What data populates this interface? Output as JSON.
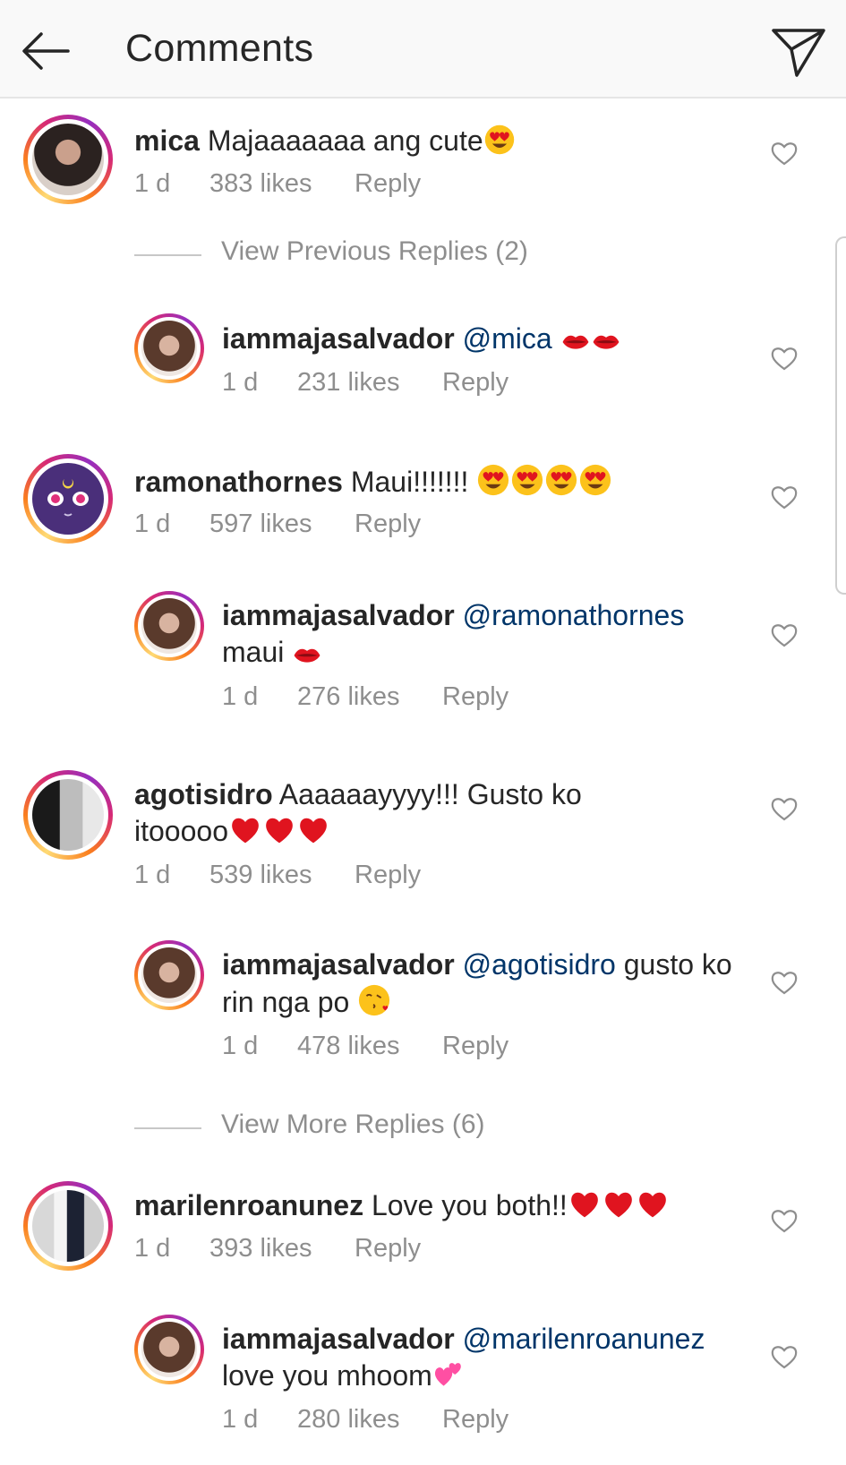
{
  "header": {
    "title": "Comments",
    "back_icon": "arrow-left-icon",
    "send_icon": "paper-plane-icon"
  },
  "comments": [
    {
      "user": "mica",
      "text": "Majaaaaaaa ang cute",
      "emoji": [
        "heart-eyes"
      ],
      "time": "1 d",
      "likes": "383 likes",
      "reply_label": "Reply",
      "view_replies": "View Previous Replies (2)",
      "reply": {
        "user": "iammajasalvador",
        "mention": "@mica",
        "text": "",
        "emoji": [
          "kiss-mark",
          "kiss-mark"
        ],
        "time": "1 d",
        "likes": "231 likes",
        "reply_label": "Reply"
      }
    },
    {
      "user": "ramonathornes",
      "text": "Maui!!!!!!!",
      "emoji": [
        "heart-eyes",
        "heart-eyes",
        "heart-eyes",
        "heart-eyes"
      ],
      "time": "1 d",
      "likes": "597 likes",
      "reply_label": "Reply",
      "reply": {
        "user": "iammajasalvador",
        "mention": "@ramonathornes",
        "text": "maui",
        "emoji": [
          "kiss-mark"
        ],
        "time": "1 d",
        "likes": "276 likes",
        "reply_label": "Reply"
      }
    },
    {
      "user": "agotisidro",
      "text": "Aaaaaayyyy!!! Gusto ko itooooo",
      "emoji": [
        "red-heart",
        "red-heart",
        "red-heart"
      ],
      "time": "1 d",
      "likes": "539 likes",
      "reply_label": "Reply",
      "reply": {
        "user": "iammajasalvador",
        "mention": "@agotisidro",
        "text": "gusto ko rin nga po",
        "emoji": [
          "face-blowing-kiss"
        ],
        "time": "1 d",
        "likes": "478 likes",
        "reply_label": "Reply"
      },
      "view_replies": "View More Replies (6)"
    },
    {
      "user": "marilenroanunez",
      "text": "Love you both!!",
      "emoji": [
        "red-heart",
        "red-heart",
        "red-heart"
      ],
      "time": "1 d",
      "likes": "393 likes",
      "reply_label": "Reply",
      "reply": {
        "user": "iammajasalvador",
        "mention": "@marilenroanunez",
        "text": "love you mhoom",
        "emoji": [
          "two-hearts"
        ],
        "time": "1 d",
        "likes": "280 likes",
        "reply_label": "Reply"
      }
    }
  ],
  "colors": {
    "mention": "#003569",
    "muted": "#8e8e8e",
    "heart_emoji": "#e0141f",
    "emoji_face": "#fcc21b"
  }
}
